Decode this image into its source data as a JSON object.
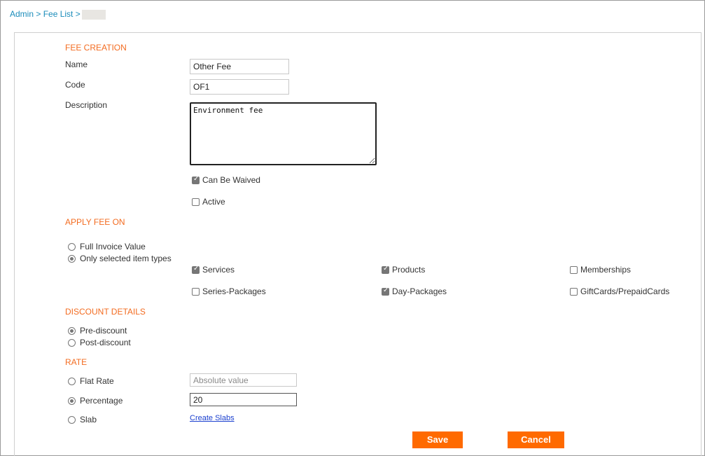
{
  "breadcrumb": {
    "admin": "Admin",
    "sep1": " > ",
    "fee_list": "Fee List",
    "sep2": " >"
  },
  "fee_creation": {
    "heading": "FEE CREATION",
    "name_label": "Name",
    "name_value": "Other Fee",
    "code_label": "Code",
    "code_value": "OF1",
    "description_label": "Description",
    "description_value": "Environment fee ",
    "can_be_waived_label": "Can Be Waived",
    "can_be_waived": true,
    "active_label": "Active",
    "active": false
  },
  "apply_fee_on": {
    "heading": "APPLY FEE ON",
    "options": [
      "Full Invoice Value",
      "Only selected item types"
    ],
    "selected": "Only selected item types",
    "item_types": [
      {
        "label": "Services",
        "checked": true
      },
      {
        "label": "Products",
        "checked": true
      },
      {
        "label": "Memberships",
        "checked": false
      },
      {
        "label": "Series-Packages",
        "checked": false
      },
      {
        "label": "Day-Packages",
        "checked": true
      },
      {
        "label": "GiftCards/PrepaidCards",
        "checked": false
      }
    ]
  },
  "discount_details": {
    "heading": "DISCOUNT DETAILS",
    "options": [
      "Pre-discount",
      "Post-discount"
    ],
    "selected": "Pre-discount"
  },
  "rate": {
    "heading": "RATE",
    "flat_rate_label": "Flat Rate",
    "flat_rate_placeholder": "Absolute value",
    "percentage_label": "Percentage",
    "percentage_value": "20",
    "slab_label": "Slab",
    "create_slabs_link": "Create Slabs",
    "selected": "Percentage"
  },
  "actions": {
    "save": "Save",
    "cancel": "Cancel"
  },
  "colors": {
    "accent": "#f36c21",
    "button": "#ff6a00",
    "link": "#1a8cba"
  }
}
